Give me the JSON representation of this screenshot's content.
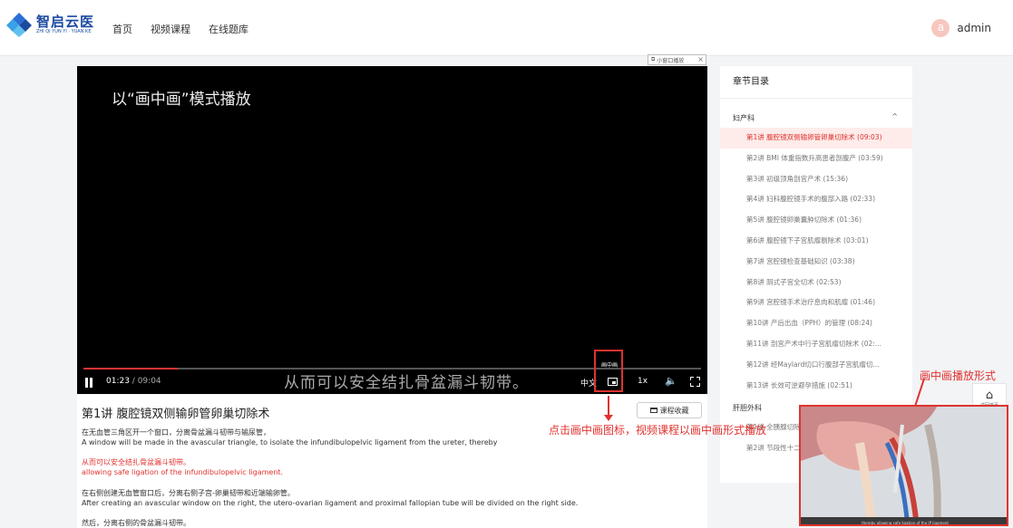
{
  "header": {
    "logo_name": "智启云医",
    "logo_sub": "ZHI QI YUN YI · YUAN KE",
    "nav": [
      "首页",
      "视频课程",
      "在线题库"
    ],
    "avatar_letter": "a",
    "username": "admin"
  },
  "player": {
    "mini_window_label": "小窗口播放",
    "mini_window_close": "×",
    "overlay_title": "以“画中画”模式播放",
    "progress": 0.152,
    "current_time": "01:23",
    "duration": "09:04",
    "subtitle": "从而可以安全结扎骨盆漏斗韧带。",
    "lang": "中文",
    "speed": "1x",
    "pip_tooltip": "画中画"
  },
  "lesson": {
    "title": "第1讲 腹腔镜双侧输卵管卵巢切除术",
    "favorite_label": "课程收藏",
    "paragraphs": [
      {
        "zh": "在无血管三角区开一个窗口，分离骨盆漏斗韧带与输尿管，",
        "en": "A window will be made in the avascular triangle, to isolate the infundibulopelvic ligament from the ureter, thereby",
        "highlight": false
      },
      {
        "zh": "从而可以安全结扎骨盆漏斗韧带。",
        "en": "allowing safe ligation of the infundibulopelvic ligament.",
        "highlight": true
      },
      {
        "zh": "在右侧创建无血管窗口后，分离右侧子宫-卵巢韧带和近端输卵管。",
        "en": "After creating an avascular window on the right, the utero-ovarian ligament and proximal fallopian tube will be divided on the right side.",
        "highlight": false
      },
      {
        "zh": "然后，分离右侧的骨盆漏斗韧带。",
        "en": "",
        "highlight": false
      }
    ]
  },
  "chapters": {
    "title": "章节目录",
    "group1": "妇产科",
    "group1_items": [
      "第1讲 腹腔镜双侧输卵管卵巢切除术 (09:03)",
      "第2讲 BMI 体重指数升高患者剖腹产 (03:59)",
      "第3讲 初级顶角剖宫产术 (15:36)",
      "第4讲 妇科腹腔镜手术的腹部入路 (02:33)",
      "第5讲 腹腔镜卵巢囊肿切除术 (01:36)",
      "第6讲 腹腔镜下子宫肌瘤剔除术 (03:01)",
      "第7讲 宫腔镜检查基础知识 (03:38)",
      "第8讲 阴式子宫全切术 (02:53)",
      "第9讲 宫腔镜手术治疗息肉和肌瘤 (01:46)",
      "第10讲 产后出血（PPH）的管理 (08:24)",
      "第11讲 剖宫产术中行子宫肌瘤切除术 (02:...",
      "第12讲 经Maylard切口行腹部子宫肌瘤切...",
      "第13讲 长效可逆避孕措施 (02:51)"
    ],
    "active_index": 0,
    "group2": "肝胆外科",
    "group2_items": [
      "第1讲 全胰腺切除术",
      "第2讲 节段性十二指肠切除术"
    ]
  },
  "side_widget": {
    "label": "返回首页"
  },
  "annotations": {
    "click_hint": "点击画中画图标，视频课程以画中画形式播放",
    "pip_label": "画中画播放形式"
  },
  "pip_window": {
    "caption": "thereby allowing safe ligation of the IP ligament"
  },
  "colors": {
    "accent": "#e0322f",
    "brand": "#1b4aa0",
    "active_bg": "#fdecea"
  }
}
